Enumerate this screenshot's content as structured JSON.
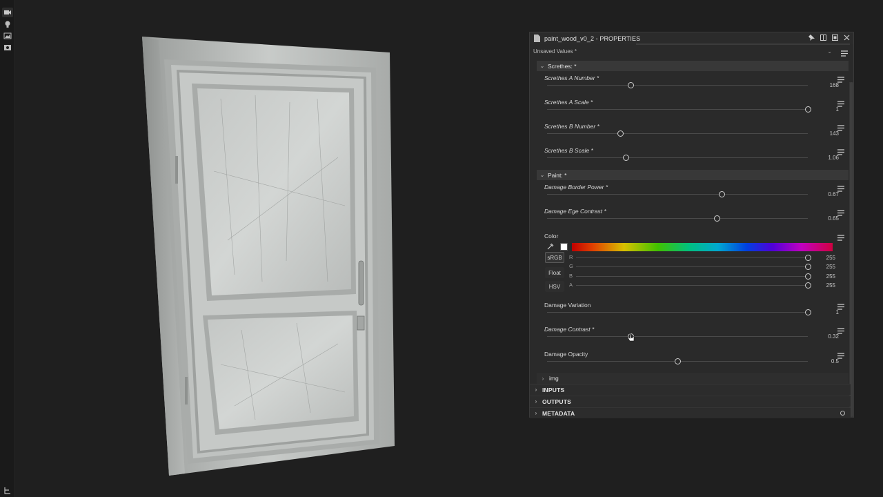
{
  "panel": {
    "title": "paint_wood_v0_2 - PROPERTIES",
    "preset_value": "Unsaved Values *"
  },
  "groups": {
    "scratches": "Screthes: *",
    "paint": "Paint: *"
  },
  "params": [
    {
      "label": "Screthes A Number *",
      "value": "168",
      "fraction": 0.32
    },
    {
      "label": "Screthes A Scale *",
      "value": "1",
      "fraction": 1.0
    },
    {
      "label": "Screthes B Number *",
      "value": "143",
      "fraction": 0.28
    },
    {
      "label": "Screthes B Scale *",
      "value": "1.06",
      "fraction": 0.302
    },
    {
      "label": "Damage Border Power *",
      "value": "0.67",
      "fraction": 0.67
    },
    {
      "label": "Damage Ege Contrast *",
      "value": "0.65",
      "fraction": 0.65
    }
  ],
  "color": {
    "label": "Color",
    "swatch": "#ffffff",
    "mode_buttons": [
      "sRGB",
      "Float",
      "HSV"
    ],
    "channels": [
      {
        "label": "R",
        "value": "255",
        "fraction": 1.0
      },
      {
        "label": "G",
        "value": "255",
        "fraction": 1.0
      },
      {
        "label": "B",
        "value": "255",
        "fraction": 1.0
      },
      {
        "label": "A",
        "value": "255",
        "fraction": 1.0
      }
    ]
  },
  "params2": [
    {
      "label": "Damage Variation",
      "value": "1",
      "fraction": 1.0,
      "italic": false
    },
    {
      "label": "Damage Contrast *",
      "value": "0.32",
      "fraction": 0.32,
      "italic": true
    },
    {
      "label": "Damage Opacity",
      "value": "0.5",
      "fraction": 0.5,
      "italic": false
    }
  ],
  "collapsed": {
    "img": "img",
    "inputs": "INPUTS",
    "outputs": "OUTPUTS",
    "metadata": "METADATA"
  },
  "icons": {
    "toolbar": [
      "camera-icon",
      "light-icon",
      "environment-icon",
      "render-icon"
    ],
    "bottom": "scene-tree-icon"
  }
}
